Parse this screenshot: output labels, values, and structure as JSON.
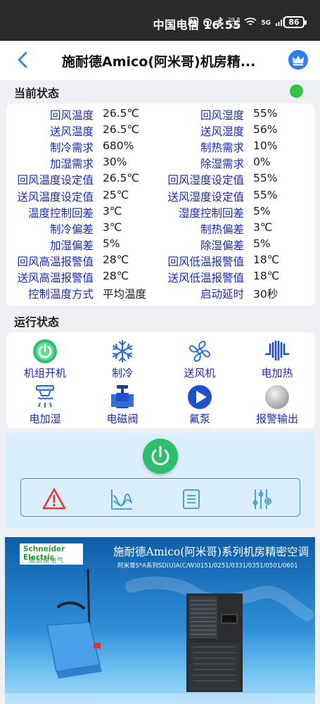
{
  "status_bar": {
    "text": "中国电信 16:55",
    "net_speed": "29.8\nK/s",
    "signal": "5G",
    "battery": "86"
  },
  "header": {
    "title": "施耐德Amico(阿米哥)机房精..."
  },
  "current_status": {
    "heading": "当前状态",
    "indicator_color": "#34c24a",
    "rows": [
      {
        "l1": "回风温度",
        "v1": "26.5℃",
        "l2": "回风湿度",
        "v2": "55%"
      },
      {
        "l1": "送风温度",
        "v1": "26.5℃",
        "l2": "送风湿度",
        "v2": "56%"
      },
      {
        "l1": "制冷需求",
        "v1": "680%",
        "l2": "制热需求",
        "v2": "10%"
      },
      {
        "l1": "加湿需求",
        "v1": "30%",
        "l2": "除湿需求",
        "v2": "0%"
      },
      {
        "l1": "回风温度设定值",
        "v1": "26.5℃",
        "l2": "回风湿度设定值",
        "v2": "55%"
      },
      {
        "l1": "送风温度设定值",
        "v1": "25℃",
        "l2": "送风湿度设定值",
        "v2": "55%"
      },
      {
        "l1": "温度控制回差",
        "v1": "3℃",
        "l2": "湿度控制回差",
        "v2": "5%"
      },
      {
        "l1": "制冷偏差",
        "v1": "3℃",
        "l2": "制热偏差",
        "v2": "3℃"
      },
      {
        "l1": "加湿偏差",
        "v1": "5%",
        "l2": "除湿偏差",
        "v2": "5%"
      },
      {
        "l1": "回风高温报警值",
        "v1": "28℃",
        "l2": "回风低温报警值",
        "v2": "18℃"
      },
      {
        "l1": "送风高温报警值",
        "v1": "28℃",
        "l2": "送风低温报警值",
        "v2": "18℃"
      },
      {
        "l1": "控制温度方式",
        "v1": "平均温度",
        "l2": "启动延时",
        "v2": "30秒"
      }
    ]
  },
  "run_status": {
    "heading": "运行状态",
    "items": [
      {
        "label": "机组开机",
        "icon": "power-icon"
      },
      {
        "label": "制冷",
        "icon": "snowflake-icon"
      },
      {
        "label": "送风机",
        "icon": "fan-icon"
      },
      {
        "label": "电加热",
        "icon": "heater-icon"
      },
      {
        "label": "电加湿",
        "icon": "humidifier-icon"
      },
      {
        "label": "电磁阀",
        "icon": "valve-icon"
      },
      {
        "label": "氟泵",
        "icon": "pump-icon"
      },
      {
        "label": "报警输出",
        "icon": "alarm-output-icon"
      }
    ]
  },
  "banner": {
    "logo_top": "Schneider Electric",
    "logo_bottom": "施耐德电气",
    "title": "施耐德Amico(阿米哥)系列机房精密空调",
    "subtitle": "阿米哥S*A系列SD(U)A(C/W)0151/0251/0331/0351/0501/0601"
  },
  "colors": {
    "accent_blue": "#1a2ab8",
    "power_green": "#2dbe6e",
    "toolbar_border": "#4a89e0"
  }
}
